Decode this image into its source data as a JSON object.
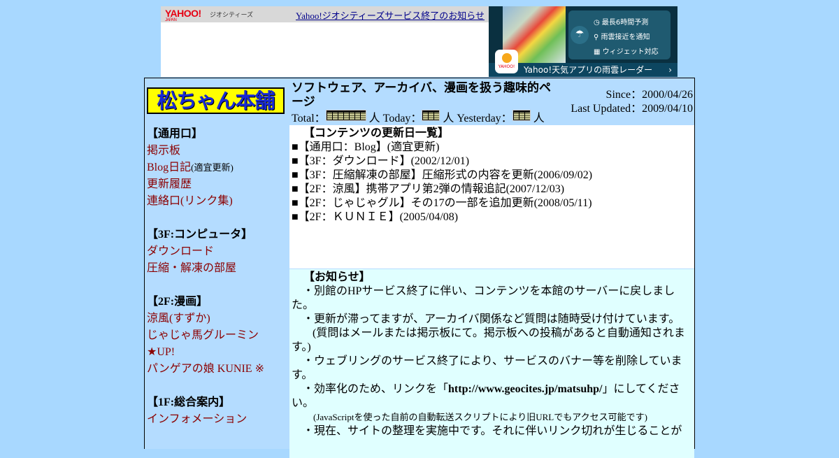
{
  "banner": {
    "logo": "YAHOO!",
    "logo_sub": "JAPAN",
    "service": "ジオシティーズ",
    "link": "Yahoo!ジオシティーズサービス終了のお知らせ"
  },
  "ad": {
    "line1": "最長6時間予測",
    "line2": "雨雲接近を通知",
    "line3": "ウィジェット対応",
    "footer": "Yahoo!天気アプリの雨雲レーダー",
    "arrow": "›",
    "app_label": "YAHOO!"
  },
  "header": {
    "logo": "松ちゃん本舗",
    "tagline": "ソフトウェア、アーカイバ、漫画を扱う趣味的ページ",
    "total_label": "Total：",
    "today_label": "人 Today：",
    "yesterday_label": "人 Yesterday：",
    "person": "人",
    "since": "Since：2000/04/26",
    "updated": "Last Updated：2009/04/10"
  },
  "nav": {
    "sec1": "【通用口】",
    "bbs": "掲示板",
    "blog": "Blog日記",
    "blog_note": "(適宜更新)",
    "history": "更新履歴",
    "links": "連絡口(リンク集)",
    "sec2": "【3F:コンピュータ】",
    "download": "ダウンロード",
    "compress": "圧縮・解凍の部屋",
    "sec3": "【2F:漫画】",
    "suzuka": "涼風(すずか)",
    "jaja": "じゃじゃ馬グルーミン",
    "up": "★UP!",
    "kunie": "パンゲアの娘 KUNIE ※",
    "sec4": "【1F:総合案内】",
    "info": "インフォメーション"
  },
  "updates": {
    "title": "【コンテンツの更新日一覧】",
    "rows": [
      "■【通用口：Blog】(適宜更新)",
      "■【3F：ダウンロード】(2002/12/01)",
      "■【3F：圧縮解凍の部屋】圧縮形式の内容を更新(2006/09/02)",
      "■【2F：涼風】携帯アプリ第2弾の情報追記(2007/12/03)",
      "■【2F：じゃじゃグル】その17の一部を追加更新(2008/05/11)",
      "■【2F：ＫＵＮＩＥ】(2005/04/08)"
    ]
  },
  "news": {
    "title": "【お知らせ】",
    "p1": "・別館のHPサービス終了に伴い、コンテンツを本館のサーバーに戻しました。",
    "p2": "・更新が滞ってますが、アーカイバ関係など質問は随時受け付けています。",
    "p3": "(質問はメールまたは掲示板にて。掲示板への投稿があると自動通知されます。)",
    "p4": "・ウェブリングのサービス終了により、サービスのバナー等を削除しています。",
    "p5a": "・効率化のため、リンクを「",
    "p5url": "http://www.geocites.jp/matsuhp/",
    "p5b": "」にしてください。",
    "p6": "(JavaScriptを使った自前の自動転送スクリプトにより旧URLでもアクセス可能です)",
    "p7": "・現在、サイトの整理を実施中です。それに伴いリンク切れが生じることが"
  }
}
